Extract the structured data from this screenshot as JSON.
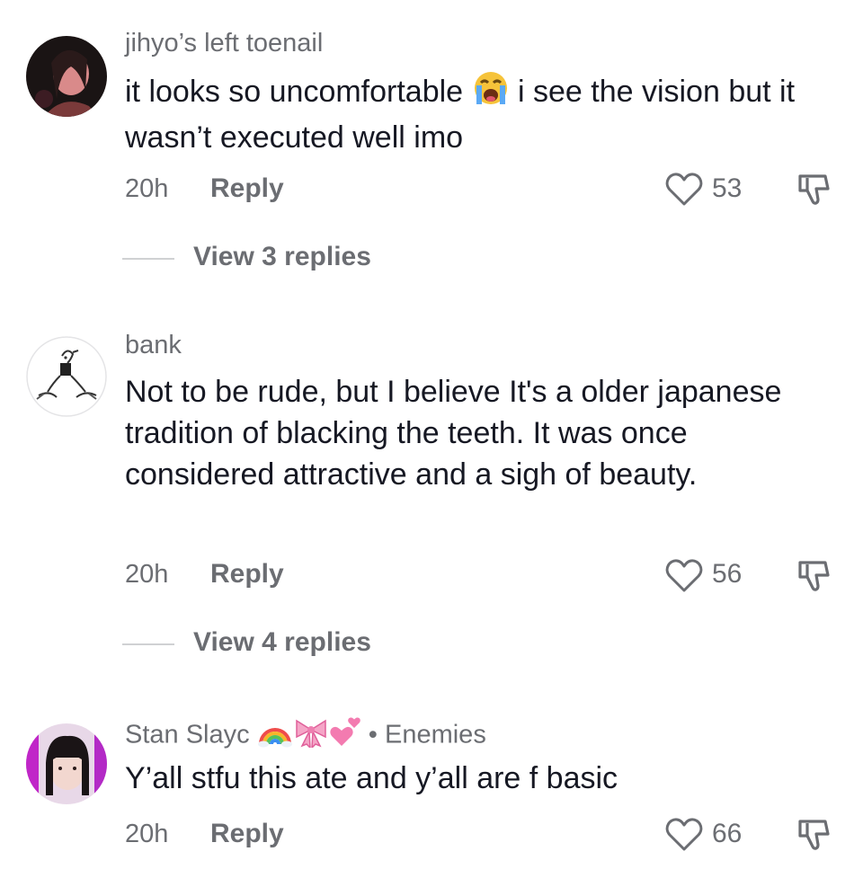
{
  "comments": [
    {
      "username": "jihyo’s left toenail",
      "text_before_emoji": "it looks so uncomfortable ",
      "emoji": "loudly-crying-face",
      "text_after_emoji": " i see the vision but it wasn’t executed well imo",
      "time": "20h",
      "reply_label": "Reply",
      "likes": "53",
      "view_replies": "View 3 replies"
    },
    {
      "username": "bank",
      "text": "Not to be rude, but I believe It's a older japanese tradition of blacking the teeth. It was once considered attractive and a sigh of beauty.",
      "time": "20h",
      "reply_label": "Reply",
      "likes": "56",
      "view_replies": "View 4 replies"
    },
    {
      "username": "Stan Slayc",
      "username_emojis": [
        "rainbow",
        "ribbon",
        "two-hearts"
      ],
      "separator": "•",
      "meta": "Enemies",
      "text": "Y’all stfu this ate and y’all are f basic",
      "time": "20h",
      "reply_label": "Reply",
      "likes": "66"
    }
  ],
  "colors": {
    "text": "#161823",
    "secondary": "#6b6d72",
    "divider": "#d0d1d3"
  }
}
